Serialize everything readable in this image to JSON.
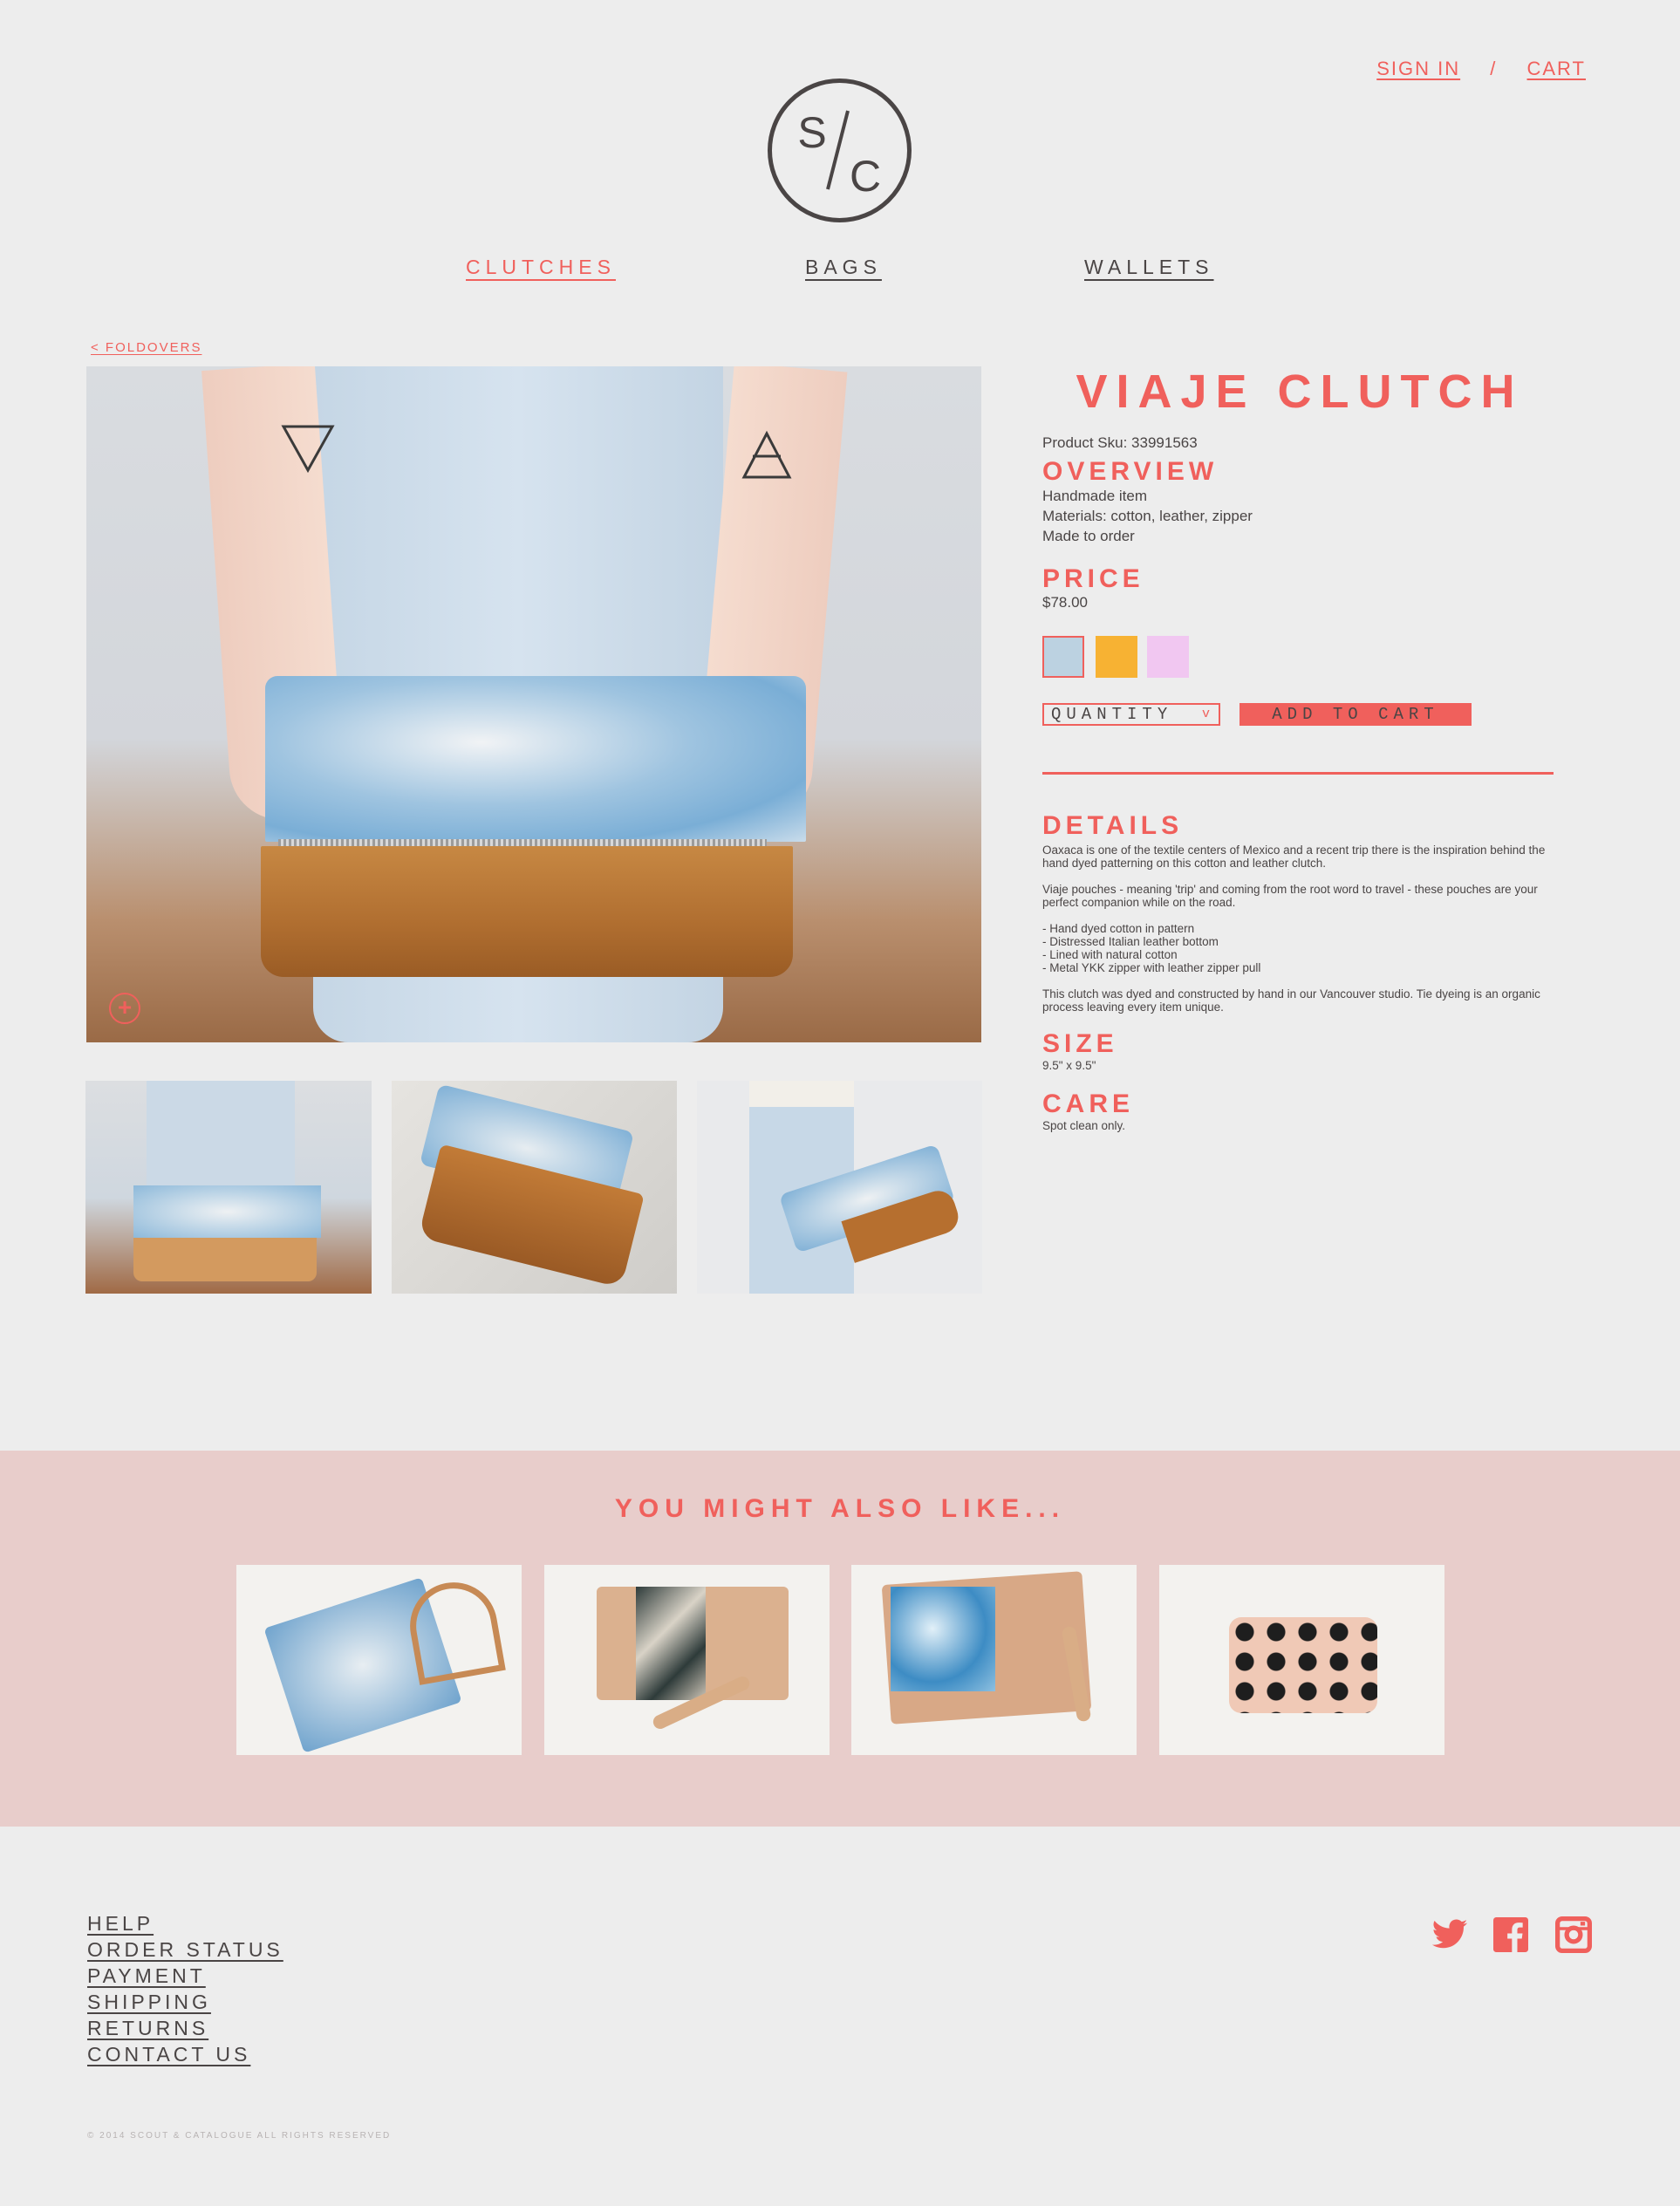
{
  "header": {
    "sign_in": "SIGN IN",
    "separator": "/",
    "cart": "CART",
    "logo_text": "S/C"
  },
  "nav": {
    "items": [
      {
        "label": "CLUTCHES",
        "active": true
      },
      {
        "label": "BAGS",
        "active": false
      },
      {
        "label": "WALLETS",
        "active": false
      }
    ]
  },
  "breadcrumb": {
    "back_label": "< FOLDOVERS"
  },
  "product": {
    "title": "VIAJE CLUTCH",
    "sku": "Product Sku: 33991563",
    "overview_heading": "OVERVIEW",
    "overview_lines": [
      "Handmade item",
      "Materials: cotton, leather, zipper",
      "Made to order"
    ],
    "price_heading": "PRICE",
    "price": "$78.00",
    "swatches": [
      "#bcd2e1",
      "#f7b233",
      "#f1c7f1"
    ],
    "quantity_label": "QUANTITY",
    "quantity_arrow": "v",
    "add_to_cart": "ADD TO CART",
    "details_heading": "DETAILS",
    "details_paragraphs": [
      "Oaxaca is one of the textile centers of Mexico and a recent trip there is the inspiration behind the hand dyed patterning on this cotton and leather clutch.",
      "Viaje pouches - meaning 'trip' and coming from the root word to travel - these pouches are your perfect companion while on the road.",
      "- Hand dyed cotton in pattern\n- Distressed Italian leather bottom\n- Lined with natural cotton\n- Metal YKK zipper with leather zipper pull",
      "This clutch was dyed and constructed by hand in our Vancouver studio. Tie dyeing is an organic process leaving every item unique."
    ],
    "size_heading": "SIZE",
    "size_value": "9.5\" x 9.5\"",
    "care_heading": "CARE",
    "care_value": "Spot clean only."
  },
  "recommendations": {
    "heading": "YOU MIGHT ALSO LIKE..."
  },
  "footer": {
    "links": [
      "HELP",
      "ORDER STATUS",
      "PAYMENT",
      "SHIPPING",
      "RETURNS",
      "CONTACT US"
    ],
    "social": [
      "twitter-icon",
      "facebook-icon",
      "instagram-icon"
    ],
    "copyright": "© 2014 SCOUT & CATALOGUE ALL RIGHTS RESERVED"
  },
  "colors": {
    "accent": "#f0605c",
    "background": "#ededed",
    "band": "#e8cdcb",
    "text": "#4a4545"
  }
}
